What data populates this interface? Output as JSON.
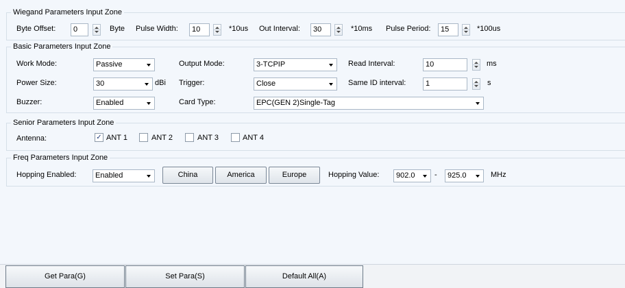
{
  "wiegand": {
    "title": "Wiegand Parameters Input Zone",
    "byte_offset_label": "Byte Offset:",
    "byte_offset_value": "0",
    "byte_unit": "Byte",
    "pulse_width_label": "Pulse Width:",
    "pulse_width_value": "10",
    "pulse_width_unit": "*10us",
    "out_interval_label": "Out Interval:",
    "out_interval_value": "30",
    "out_interval_unit": "*10ms",
    "pulse_period_label": "Pulse Period:",
    "pulse_period_value": "15",
    "pulse_period_unit": "*100us"
  },
  "basic": {
    "title": "Basic Parameters Input Zone",
    "work_mode_label": "Work Mode:",
    "work_mode_value": "Passive",
    "output_mode_label": "Output Mode:",
    "output_mode_value": "3-TCPIP",
    "read_interval_label": "Read Interval:",
    "read_interval_value": "10",
    "read_interval_unit": "ms",
    "power_size_label": "Power Size:",
    "power_size_value": "30",
    "power_unit": "dBi",
    "trigger_label": "Trigger:",
    "trigger_value": "Close",
    "same_id_label": "Same ID interval:",
    "same_id_value": "1",
    "same_id_unit": "s",
    "buzzer_label": "Buzzer:",
    "buzzer_value": "Enabled",
    "card_type_label": "Card Type:",
    "card_type_value": "EPC(GEN 2)Single-Tag"
  },
  "senior": {
    "title": "Senior Parameters Input Zone",
    "antenna_label": "Antenna:",
    "antennas": [
      {
        "label": "ANT 1",
        "checked": true,
        "mark": "✓"
      },
      {
        "label": "ANT 2",
        "checked": false,
        "mark": ""
      },
      {
        "label": "ANT 3",
        "checked": false,
        "mark": ""
      },
      {
        "label": "ANT 4",
        "checked": false,
        "mark": ""
      }
    ]
  },
  "freq": {
    "title": "Freq Parameters Input Zone",
    "hopping_enabled_label": "Hopping Enabled:",
    "hopping_enabled_value": "Enabled",
    "china_label": "China",
    "america_label": "America",
    "europe_label": "Europe",
    "hopping_value_label": "Hopping Value:",
    "hopping_from": "902.0",
    "separator": "-",
    "hopping_to": "925.0",
    "unit": "MHz"
  },
  "actions": {
    "get_para": "Get Para(G)",
    "set_para": "Set Para(S)",
    "default_all": "Default All(A)"
  },
  "colors": {
    "background": "#f3f7fc",
    "group_border": "#d5dfe8",
    "checkmark": "#1f3a78"
  }
}
